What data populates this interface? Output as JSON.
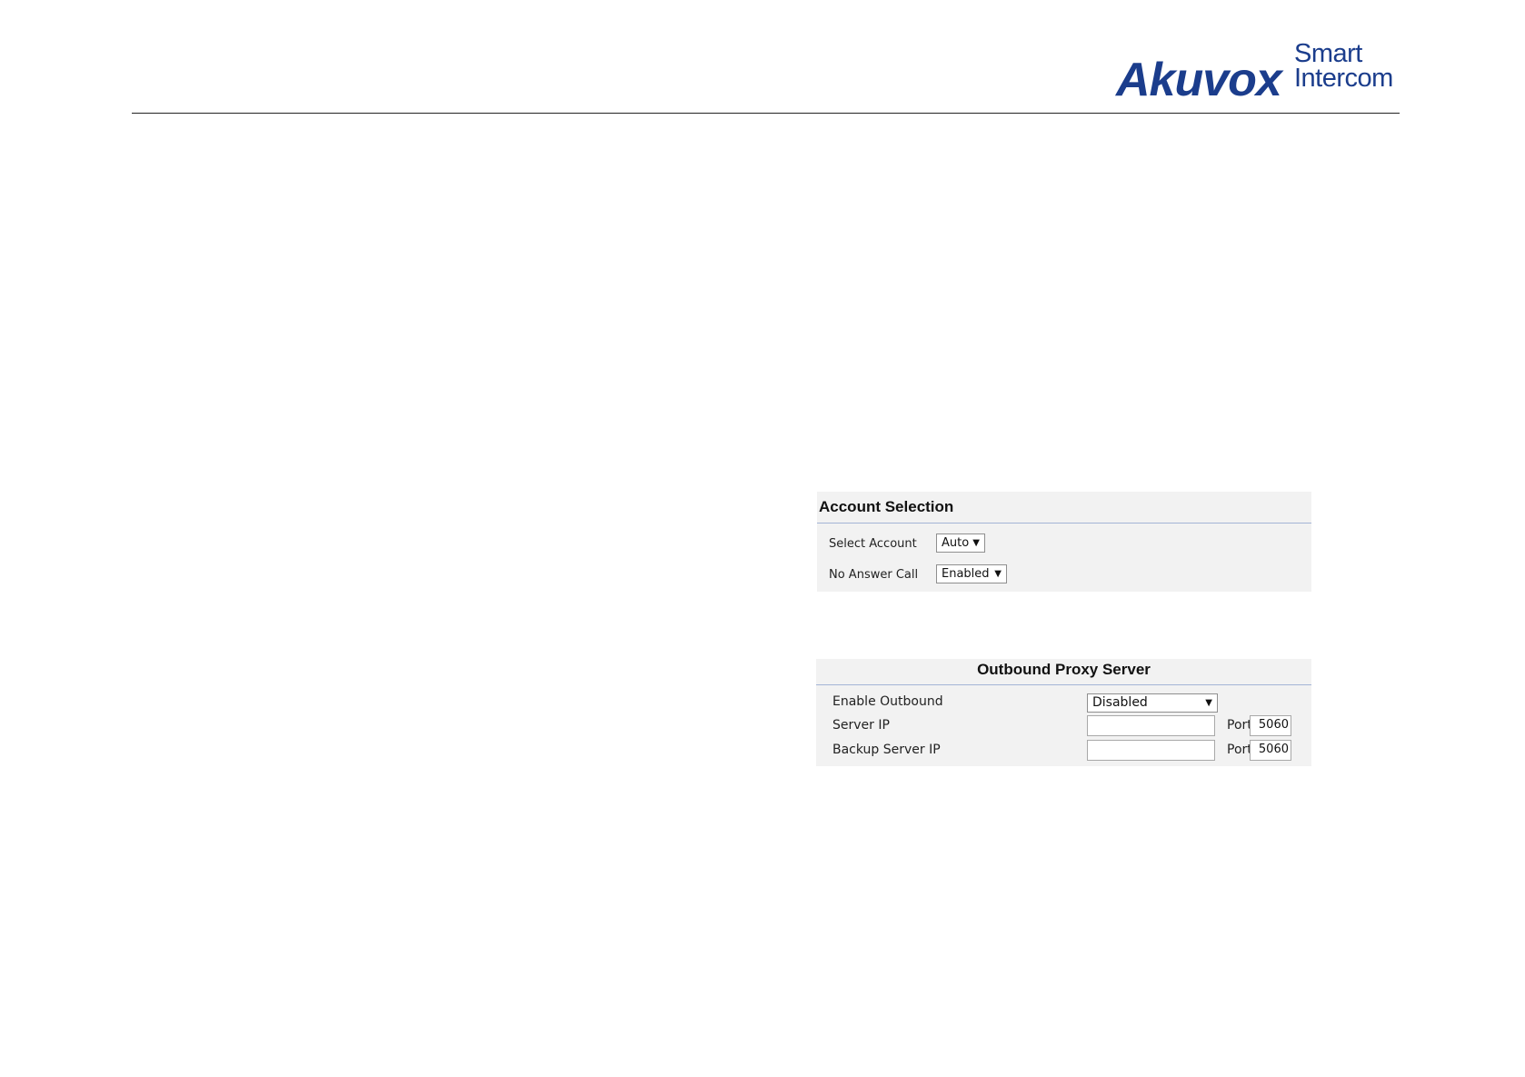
{
  "header": {
    "logo_main": "Akuvox",
    "logo_sub": "Smart Intercom"
  },
  "account_selection": {
    "title": "Account Selection",
    "select_account_label": "Select Account",
    "select_account_value": "Auto",
    "no_answer_call_label": "No Answer Call",
    "no_answer_call_value": "Enabled"
  },
  "outbound_proxy": {
    "title": "Outbound Proxy Server",
    "enable_outbound_label": "Enable Outbound",
    "enable_outbound_value": "Disabled",
    "server_ip_label": "Server IP",
    "server_ip_value": "",
    "backup_server_ip_label": "Backup Server IP",
    "backup_server_ip_value": "",
    "port_label": "Port",
    "server_port_value": "5060",
    "backup_port_value": "5060"
  },
  "icons": {
    "dropdown": "caret-down-icon"
  }
}
